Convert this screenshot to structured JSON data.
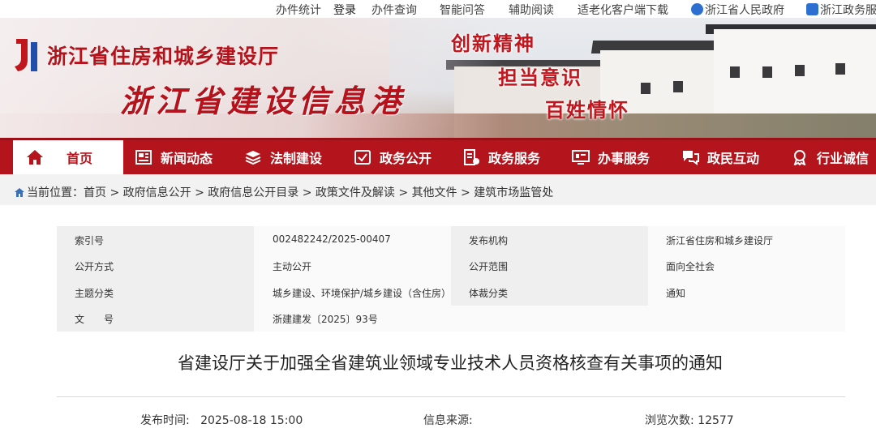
{
  "topbar": {
    "links": [
      "办件统计",
      "登录",
      "办件查询",
      "智能问答",
      "辅助阅读",
      "适老化客户端下载",
      "浙江省人民政府",
      "浙江政务服"
    ]
  },
  "banner": {
    "dept_title": "浙江省住房和城乡建设厅",
    "site_title": "浙江省建设信息港",
    "slogans": [
      "创新精神",
      "担当意识",
      "百姓情怀"
    ]
  },
  "nav": {
    "items": [
      {
        "label": "首页",
        "icon": "home-icon"
      },
      {
        "label": "新闻动态",
        "icon": "news-icon"
      },
      {
        "label": "法制建设",
        "icon": "layers-icon"
      },
      {
        "label": "政务公开",
        "icon": "disclosure-icon"
      },
      {
        "label": "政务服务",
        "icon": "service-icon"
      },
      {
        "label": "办事服务",
        "icon": "monitor-icon"
      },
      {
        "label": "政民互动",
        "icon": "chat-icon"
      },
      {
        "label": "行业诚信",
        "icon": "badge-icon"
      }
    ]
  },
  "breadcrumb": {
    "prefix": "当前位置：",
    "items": [
      "首页",
      "政府信息公开",
      "政府信息公开目录",
      "政策文件及解读",
      "其他文件",
      "建筑市场监管处"
    ],
    "separator": " > "
  },
  "meta": {
    "rows": [
      {
        "label1": "索引号",
        "value1": "002482242/2025-00407",
        "label2": "发布机构",
        "value2": "浙江省住房和城乡建设厅"
      },
      {
        "label1": "公开方式",
        "value1": "主动公开",
        "label2": "公开范围",
        "value2": "面向全社会"
      },
      {
        "label1": "主题分类",
        "value1": "城乡建设、环境保护/城乡建设（含住房）",
        "label2": "体裁分类",
        "value2": "通知"
      },
      {
        "label1": "文　　号",
        "value1": "浙建建发〔2025〕93号",
        "label2": "",
        "value2": ""
      }
    ]
  },
  "article": {
    "title": "省建设厅关于加强全省建筑业领域专业技术人员资格核查有关事项的通知",
    "publish_label": "发布时间:",
    "publish_time": "2025-08-18 15:00",
    "source_label": "信息来源:",
    "source_value": "",
    "views_label": "浏览次数:",
    "views": "12577"
  },
  "colors": {
    "brand_red": "#b4141c",
    "title_red": "#b5121b"
  }
}
